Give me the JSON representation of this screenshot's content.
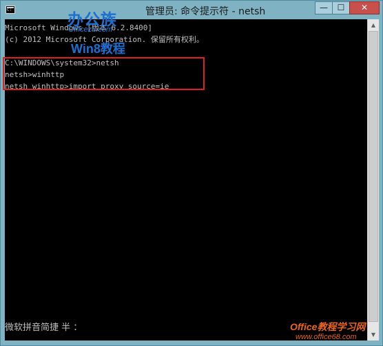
{
  "window": {
    "title": "管理员: 命令提示符 - netsh",
    "minimize_glyph": "—",
    "maximize_glyph": "☐",
    "close_glyph": "✕",
    "app_icon": "cmd-icon"
  },
  "watermark": {
    "line1": "办公族",
    "line2": "Officezu.com",
    "line3": "Win8教程"
  },
  "console": {
    "lines": [
      "Microsoft Windows [版本 6.2.8400]",
      "(c) 2012 Microsoft Corporation. 保留所有权利。",
      "",
      "C:\\WINDOWS\\system32>netsh",
      "netsh>winhttp",
      "netsh winhttp>import proxy source=ie"
    ],
    "ime_status": "微软拼音简捷 半 ："
  },
  "footer_watermark": {
    "brand": "Office",
    "brand_rest": "教程学习网",
    "url": "www.office68.com"
  },
  "colors": {
    "frame": "#7fb2c3",
    "console_bg": "#000000",
    "console_text": "#c0c0c0",
    "highlight": "#e0201b",
    "close_button": "#c7504d"
  }
}
